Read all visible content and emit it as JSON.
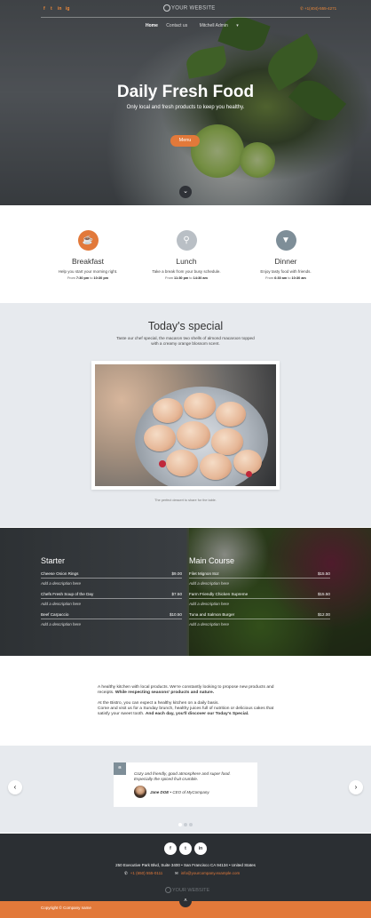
{
  "topbar": {
    "social": [
      "f",
      "t",
      "in",
      "ig"
    ],
    "logo": "YOUR WEBSITE",
    "phone": "+1(404)-555-4271"
  },
  "nav": {
    "items": [
      "Home",
      "Contact us",
      "Mitchell Admin"
    ]
  },
  "hero": {
    "title": "Daily Fresh Food",
    "subtitle": "Only local and fresh products to keep you healthy.",
    "button": "Menu"
  },
  "meals": [
    {
      "title": "Breakfast",
      "desc": "Help you start your morning right.",
      "hours_from": "7:30 pm",
      "hours_to": "10:30 pm",
      "color": "#e2793a",
      "icon": "coffee-icon"
    },
    {
      "title": "Lunch",
      "desc": "Take a break from your busy schedule.",
      "hours_from": "11:30 pm",
      "hours_to": "14:30 am",
      "color": "#b9bfc5",
      "icon": "cutlery-icon"
    },
    {
      "title": "Dinner",
      "desc": "Enjoy tasty food with friends.",
      "hours_from": "6:30 am",
      "hours_to": "10:30 am",
      "color": "#7e8e98",
      "icon": "cocktail-icon"
    }
  ],
  "hours_labels": {
    "from": "From",
    "to": "to"
  },
  "special": {
    "title": "Today's special",
    "desc": "Taste our chef special, the macaron two shells of almond macaroon topped with a creamy orange blossom scent.",
    "caption": "The perfect dessert to share for the table."
  },
  "menu": {
    "starter": {
      "title": "Starter",
      "items": [
        {
          "name": "Cheese Onion Rings",
          "price": "$9.00",
          "desc": "Add a description here"
        },
        {
          "name": "Chefs Fresh Soup of the Day",
          "price": "$7.50",
          "desc": "Add a description here"
        },
        {
          "name": "Beef Carpaccio",
          "price": "$10.50",
          "desc": "Add a description here"
        }
      ]
    },
    "main": {
      "title": "Main Course",
      "items": [
        {
          "name": "Filet Mignon 8oz",
          "price": "$15.50",
          "desc": "Add a description here"
        },
        {
          "name": "Farm Friendly Chicken Supreme",
          "price": "$15.50",
          "desc": "Add a description here"
        },
        {
          "name": "Tuna and Salmon Burger",
          "price": "$12.00",
          "desc": "Add a description here"
        }
      ]
    }
  },
  "about": {
    "p1a": "A healthy kitchen with local products. We're constantly looking to propose new products and receipts.",
    "p1b": "While respecting seasons' products and nature.",
    "p2a": "At the Bistro, you can expect a healthy kitchen on a daily basis.",
    "p2b": "Come and visit us for a Sunday brunch, healthy juices full of nutrition or delicious cakes that satisfy your sweet tooth.",
    "p2c": "And each day, you'll discover our Today's Special."
  },
  "testimonial": {
    "quote": "Cozy and friendly, good atmosphere and super food. Especially the spiced fruit crumble.",
    "author_name": "Jane DOE",
    "author_role": "• CEO of MyCompany"
  },
  "footer": {
    "social": [
      "f",
      "t",
      "in"
    ],
    "address": "250 Executive Park Blvd, Suite 3400 • San Francisco CA 94134 • United States",
    "phone": "+1 (650) 555-0111",
    "email": "info@yourcompany.example.com",
    "logo": "YOUR WEBSITE",
    "copyright": "Copyright © Company name"
  },
  "colors": {
    "accent": "#e2793a",
    "dark": "#2b2f33",
    "light_section": "#e7eaee"
  }
}
